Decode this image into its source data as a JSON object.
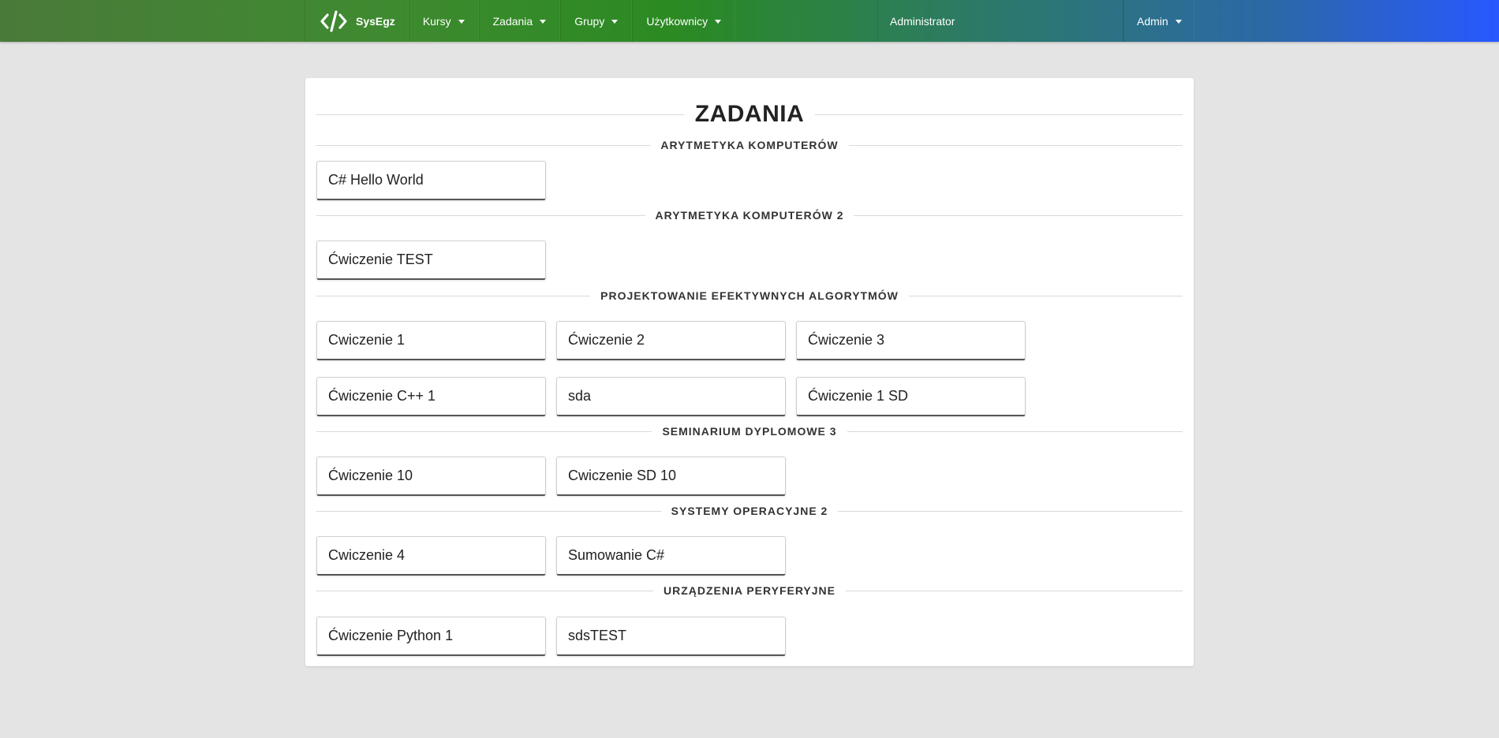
{
  "navbar": {
    "brand": "SysEgz",
    "menus": [
      {
        "label": "Kursy"
      },
      {
        "label": "Zadania"
      },
      {
        "label": "Grupy"
      },
      {
        "label": "Użytkownicy"
      }
    ],
    "role_text": "Administrator",
    "user_menu": "Admin"
  },
  "page": {
    "title": "ZADANIA"
  },
  "sections": [
    {
      "title": "ARYTMETYKA KOMPUTERÓW",
      "tasks": [
        "C# Hello World"
      ]
    },
    {
      "title": "ARYTMETYKA KOMPUTERÓW 2",
      "tasks": [
        "Ćwiczenie TEST"
      ]
    },
    {
      "title": "PROJEKTOWANIE EFEKTYWNYCH ALGORYTMÓW",
      "tasks": [
        "Cwiczenie 1",
        "Ćwiczenie 2",
        "Ćwiczenie 3",
        "Ćwiczenie C++ 1",
        "sda",
        "Ćwiczenie 1 SD"
      ]
    },
    {
      "title": "SEMINARIUM DYPLOMOWE 3",
      "tasks": [
        "Ćwiczenie 10",
        "Cwiczenie SD 10"
      ]
    },
    {
      "title": "SYSTEMY OPERACYJNE 2",
      "tasks": [
        "Cwiczenie 4",
        "Sumowanie C#"
      ]
    },
    {
      "title": "URZĄDZENIA PERYFERYJNE",
      "tasks": [
        "Ćwiczenie Python 1",
        "sdsTEST"
      ]
    }
  ],
  "icons": {
    "brand": "code-icon",
    "caret": "caret-down-icon"
  }
}
